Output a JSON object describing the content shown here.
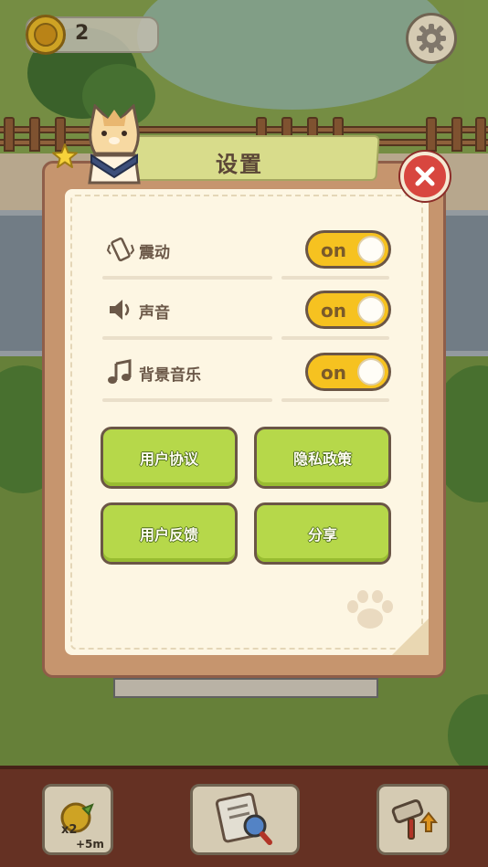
{
  "hud": {
    "coin_count": "2"
  },
  "settings": {
    "title": "设置",
    "rows": [
      {
        "label": "震动",
        "state": "on"
      },
      {
        "label": "声音",
        "state": "on"
      },
      {
        "label": "背景音乐",
        "state": "on"
      }
    ],
    "buttons": {
      "user_agreement": "用户协议",
      "privacy_policy": "隐私政策",
      "feedback": "用户反馈",
      "share": "分享"
    }
  },
  "bottom_bar": {
    "boost_multiplier": "x2",
    "boost_duration": "+5m"
  },
  "colors": {
    "toggle_on": "#f6c220",
    "button_green": "#b6d84a",
    "close_red": "#d8463f",
    "panel_brown": "#c6956e"
  }
}
